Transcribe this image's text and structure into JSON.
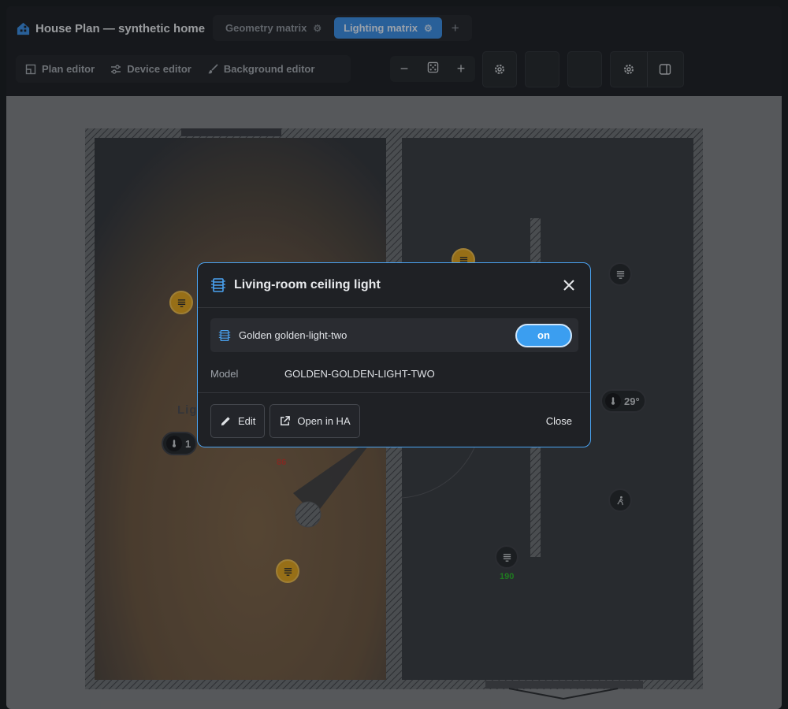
{
  "app": {
    "title": "House Plan — synthetic home"
  },
  "tabs": [
    {
      "label": "Geometry matrix",
      "active": false
    },
    {
      "label": "Lighting matrix",
      "active": true
    }
  ],
  "tab_add_label": "+",
  "editors": [
    {
      "label": "Plan editor",
      "icon": "floorplan-icon"
    },
    {
      "label": "Device editor",
      "icon": "sliders-icon"
    },
    {
      "label": "Background editor",
      "icon": "brush-icon"
    }
  ],
  "zoom": {
    "out": "−",
    "in": "+"
  },
  "plan": {
    "room_label_left": "Lig",
    "temps": [
      {
        "value": "1",
        "room": "left"
      },
      {
        "value": "29°",
        "room": "right"
      }
    ],
    "device_labels": [
      {
        "text": "86",
        "color": "#c03b2e"
      },
      {
        "text": "190",
        "color": "#2bb52a"
      }
    ]
  },
  "dialog": {
    "title": "Living-room ceiling light",
    "entity_name": "Golden golden-light-two",
    "toggle_label": "on",
    "model_key": "Model",
    "model_value": "GOLDEN-GOLDEN-LIGHT-TWO",
    "edit_label": "Edit",
    "open_label": "Open in HA",
    "close_label": "Close"
  },
  "colors": {
    "accent": "#3b8ee4",
    "light_on": "#e3a51c"
  }
}
